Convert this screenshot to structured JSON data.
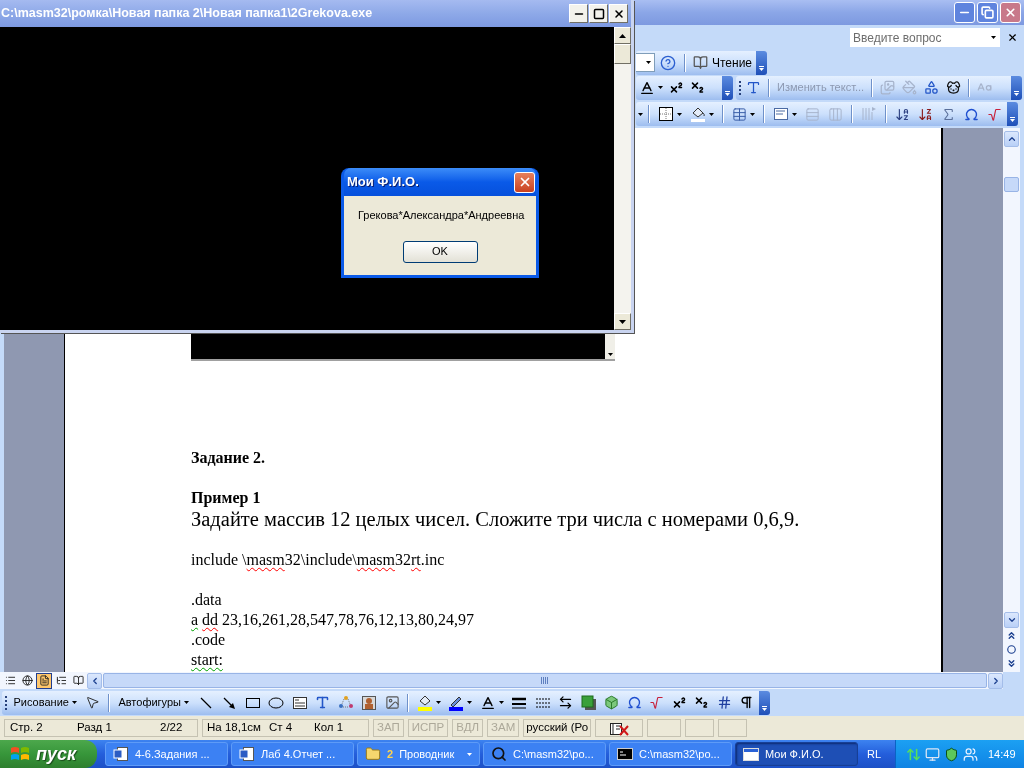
{
  "word_window": {
    "help_search": {
      "placeholder": "Введите вопрос"
    },
    "standard_toolbar": {
      "reading_button": "Чтение"
    },
    "wordart_toolbar": [
      {
        "kind": "insert",
        "disabled": false
      },
      {
        "kind": "edit_text",
        "label": "Изменить текст...",
        "disabled": true
      },
      {
        "kind": "gallery",
        "disabled": true
      },
      {
        "kind": "format",
        "disabled": true
      },
      {
        "kind": "shape",
        "disabled": false
      },
      {
        "kind": "wrap",
        "disabled": false
      },
      {
        "kind": "same_height",
        "disabled": true
      }
    ],
    "tables_toolbar": [
      {
        "kind": "borders",
        "disabled": false
      },
      {
        "kind": "shading",
        "disabled": false
      },
      {
        "kind": "table",
        "disabled": false
      },
      {
        "kind": "align",
        "disabled": false
      },
      {
        "kind": "distribute_rows",
        "disabled": true
      },
      {
        "kind": "distribute_columns",
        "disabled": true
      },
      {
        "kind": "text_direction",
        "disabled": true
      },
      {
        "kind": "sort_ascending",
        "disabled": false
      },
      {
        "kind": "sort_descending",
        "disabled": false
      },
      {
        "kind": "autosum",
        "disabled": false
      },
      {
        "kind": "symbol",
        "disabled": false
      },
      {
        "kind": "equation",
        "disabled": false
      }
    ],
    "document": {
      "blocks": [
        {
          "lines": [
            {
              "kind": "heading",
              "segments": [
                {
                  "text": "Задание 2.",
                  "spelling_error": false,
                  "grammar_error": false
                }
              ]
            }
          ]
        },
        {
          "lines": [
            {
              "kind": "heading",
              "segments": [
                {
                  "text": "Пример 1",
                  "spelling_error": false,
                  "grammar_error": false
                }
              ]
            },
            {
              "kind": "large",
              "segments": [
                {
                  "text": "Задайте массив 12 целых чисел. Сложите три числа с номерами 0,6,9.",
                  "spelling_error": false,
                  "grammar_error": false
                }
              ]
            }
          ]
        },
        {
          "lines": [
            {
              "kind": "plain",
              "segments": [
                {
                  "text": "include \\",
                  "spelling_error": false,
                  "grammar_error": false
                },
                {
                  "text": "masm",
                  "spelling_error": true,
                  "grammar_error": false
                },
                {
                  "text": "32\\include\\",
                  "spelling_error": false,
                  "grammar_error": false
                },
                {
                  "text": "masm",
                  "spelling_error": true,
                  "grammar_error": false
                },
                {
                  "text": "32",
                  "spelling_error": false,
                  "grammar_error": false
                },
                {
                  "text": "rt",
                  "spelling_error": true,
                  "grammar_error": false
                },
                {
                  "text": ".inc",
                  "spelling_error": false,
                  "grammar_error": false
                }
              ]
            }
          ]
        },
        {
          "lines": [
            {
              "kind": "plain",
              "segments": [
                {
                  "text": ".data",
                  "spelling_error": false,
                  "grammar_error": false
                }
              ]
            },
            {
              "kind": "plain",
              "segments": [
                {
                  "text": "a ",
                  "spelling_error": false,
                  "grammar_error": true
                },
                {
                  "text": "dd",
                  "spelling_error": true,
                  "grammar_error": false
                },
                {
                  "text": " 23,16,261,28,547,78,76,12,13,80,24,97",
                  "spelling_error": false,
                  "grammar_error": false
                }
              ]
            },
            {
              "kind": "plain",
              "segments": [
                {
                  "text": ".code",
                  "spelling_error": false,
                  "grammar_error": false
                }
              ]
            },
            {
              "kind": "plain",
              "segments": [
                {
                  "text": "start:",
                  "spelling_error": false,
                  "grammar_error": true
                }
              ]
            }
          ]
        }
      ]
    },
    "view_buttons": [
      {
        "kind": "normal",
        "selected": false
      },
      {
        "kind": "web",
        "selected": false
      },
      {
        "kind": "print",
        "selected": true
      },
      {
        "kind": "outline",
        "selected": false
      },
      {
        "kind": "reading",
        "selected": false
      }
    ],
    "drawing_toolbar": {
      "drawing_menu": "Рисование",
      "autoshapes_menu": "Автофигуры"
    },
    "status_bar": {
      "position": [
        "Стр. 2",
        "Разд 1",
        "2/22"
      ],
      "location": [
        "На 18,1см",
        "Ст 4",
        "Кол 1"
      ],
      "modes": [
        {
          "label": "ЗАП",
          "on": false
        },
        {
          "label": "ИСПР",
          "on": false
        },
        {
          "label": "ВДЛ",
          "on": false
        },
        {
          "label": "ЗАМ",
          "on": false
        }
      ],
      "language": "русский (Ро"
    }
  },
  "console_window": {
    "title": "C:\\masm32\\ромка\\Новая папка 2\\Новая папка1\\2Grekova.exe"
  },
  "message_box": {
    "title": "Мои Ф.И.О.",
    "message": "Грекова*Александра*Андреевна",
    "buttons": [
      "OK"
    ]
  },
  "taskbar": {
    "start_button": "пуск",
    "tasks": [
      {
        "kind": "document",
        "label": "4-6.Задания ...",
        "selected": false
      },
      {
        "kind": "document",
        "label": "Лаб 4.Отчет ...",
        "selected": false
      },
      {
        "kind": "group",
        "count": "2",
        "label": "Проводник",
        "selected": false
      },
      {
        "kind": "search",
        "label": "C:\\masm32\\ро...",
        "selected": false
      },
      {
        "kind": "console",
        "label": "C:\\masm32\\ро...",
        "selected": false
      },
      {
        "kind": "window",
        "label": "Мои Ф.И.О.",
        "selected": true
      }
    ],
    "language": "RL",
    "clock": "14:49"
  }
}
